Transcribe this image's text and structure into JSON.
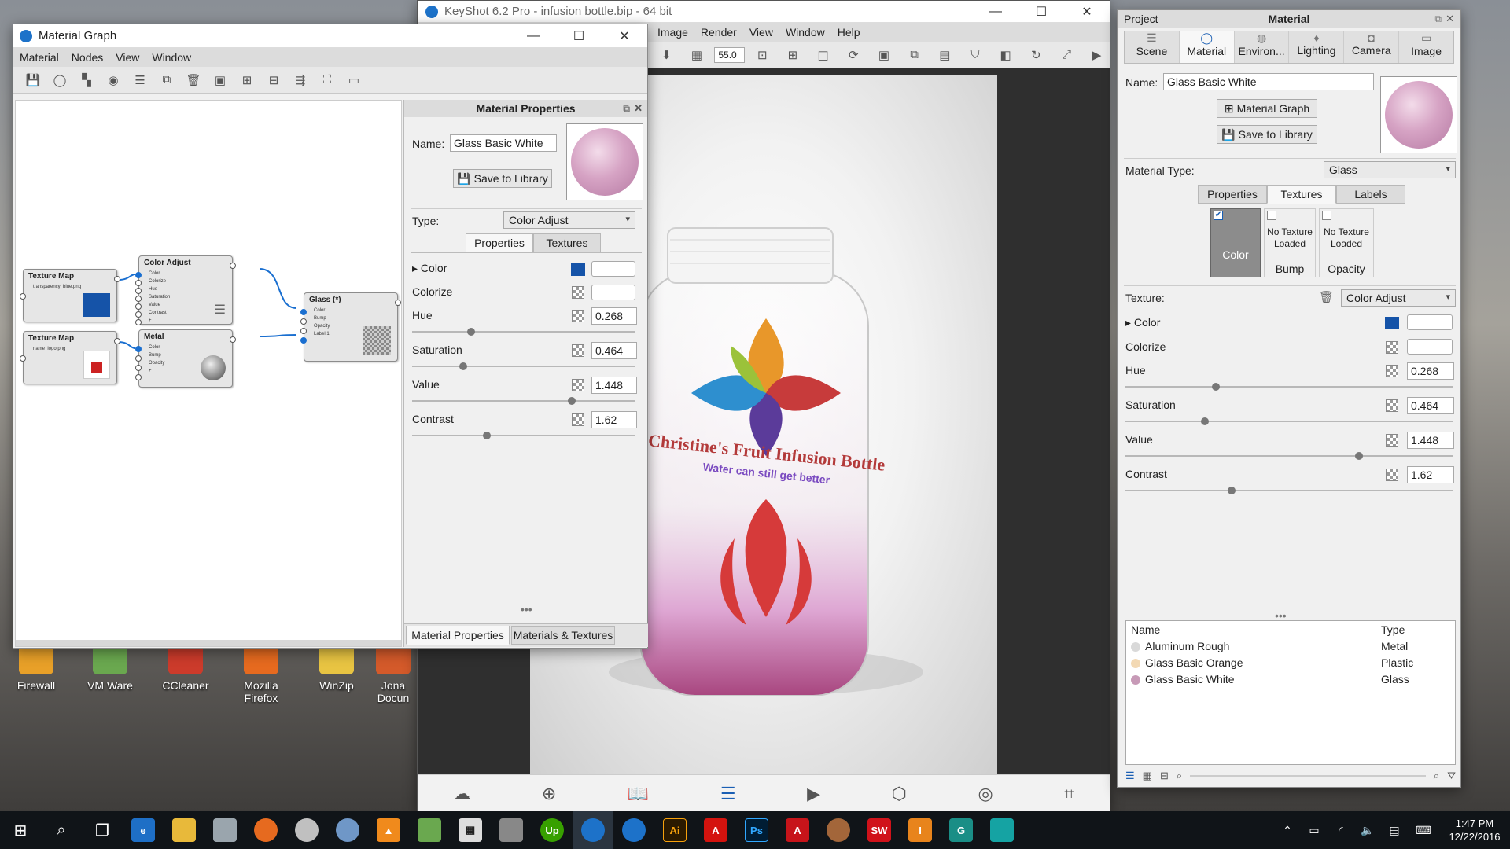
{
  "colors": {
    "accent": "#1a5fb4",
    "swatch": "#1553a8",
    "node_port": "#1a6fd0"
  },
  "desktop": {
    "icons": [
      {
        "label": "Firewall"
      },
      {
        "label": "VM Ware"
      },
      {
        "label": "CCleaner"
      },
      {
        "label": "Mozilla Firefox"
      },
      {
        "label": "WinZip"
      },
      {
        "label": "Jona Docun"
      }
    ]
  },
  "keyshot": {
    "title": "KeyShot 6.2 Pro  -  infusion bottle.bip  -  64 bit",
    "menu": [
      "Image",
      "Render",
      "View",
      "Window",
      "Help"
    ],
    "zoom": "55.0",
    "bottom_tools": [
      "Cloud Library",
      "Import",
      "Library",
      "Project",
      "Animation",
      "KeyShotVR",
      "Render",
      "Screenshot"
    ],
    "bottle_text_1": "Christine's Fruit Infusion Bottle",
    "bottle_text_2": "Water can still get better"
  },
  "material_graph": {
    "title": "Material Graph",
    "menu": [
      "Material",
      "Nodes",
      "View",
      "Window"
    ],
    "nodes": {
      "texture1": {
        "title": "Texture Map",
        "sub": "transparency_blue.png"
      },
      "texture2": {
        "title": "Texture Map",
        "sub": "name_logo.png"
      },
      "coloradjust": {
        "title": "Color Adjust",
        "ports": [
          "Color",
          "Colorize",
          "Hue",
          "Saturation",
          "Value",
          "Contrast",
          "+"
        ]
      },
      "metal": {
        "title": "Metal",
        "ports": [
          "Color",
          "Bump",
          "Opacity",
          "+"
        ]
      },
      "glass": {
        "title": "Glass (*)",
        "ports": [
          "Color",
          "Bump",
          "Opacity",
          "Label 1"
        ]
      }
    }
  },
  "material_properties": {
    "title": "Material Properties",
    "name_label": "Name:",
    "name_value": "Glass Basic White",
    "save_label": "Save to Library",
    "type_label": "Type:",
    "type_value": "Color Adjust",
    "tabs": [
      "Properties",
      "Textures"
    ],
    "props": [
      {
        "label": "Color",
        "value": ""
      },
      {
        "label": "Colorize",
        "value": ""
      },
      {
        "label": "Hue",
        "value": "0.268"
      },
      {
        "label": "Saturation",
        "value": "0.464"
      },
      {
        "label": "Value",
        "value": "1.448"
      },
      {
        "label": "Contrast",
        "value": "1.62"
      }
    ],
    "bottom_tabs": [
      "Material Properties",
      "Materials & Textures"
    ]
  },
  "project": {
    "panel_title_left": "Project",
    "panel_title": "Material",
    "tabs": [
      "Scene",
      "Material",
      "Environ...",
      "Lighting",
      "Camera",
      "Image"
    ],
    "name_label": "Name:",
    "name_value": "Glass Basic White",
    "graph_btn": "Material Graph",
    "save_btn": "Save to Library",
    "type_label": "Material Type:",
    "type_value": "Glass",
    "subtabs": [
      "Properties",
      "Textures",
      "Labels"
    ],
    "slots": [
      {
        "label": "Color",
        "text": ""
      },
      {
        "label": "Bump",
        "text": "No Texture Loaded"
      },
      {
        "label": "Opacity",
        "text": "No Texture Loaded"
      }
    ],
    "texture_label": "Texture:",
    "texture_value": "Color Adjust",
    "props": [
      {
        "label": "Color",
        "value": ""
      },
      {
        "label": "Colorize",
        "value": ""
      },
      {
        "label": "Hue",
        "value": "0.268"
      },
      {
        "label": "Saturation",
        "value": "0.464"
      },
      {
        "label": "Value",
        "value": "1.448"
      },
      {
        "label": "Contrast",
        "value": "1.62"
      }
    ],
    "list_headers": [
      "Name",
      "Type"
    ],
    "list": [
      {
        "name": "Aluminum Rough",
        "type": "Metal",
        "color": "#d9d9d9"
      },
      {
        "name": "Glass Basic Orange",
        "type": "Plastic",
        "color": "#f3d9b4"
      },
      {
        "name": "Glass Basic White",
        "type": "Glass",
        "color": "#c79ab7"
      }
    ]
  },
  "taskbar": {
    "time": "1:47 PM",
    "date": "12/22/2016"
  }
}
